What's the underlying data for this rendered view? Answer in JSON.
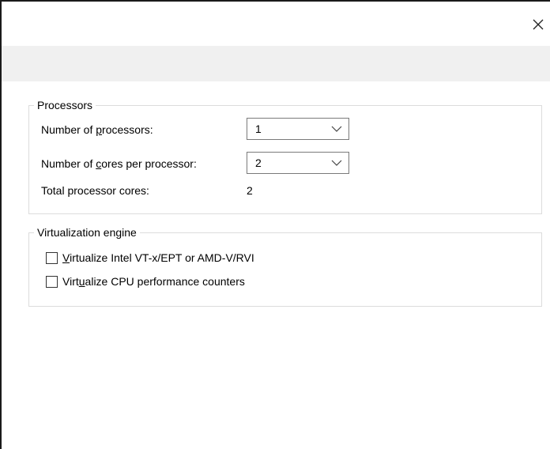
{
  "window": {
    "close_icon": "close-icon"
  },
  "processors": {
    "group_label": "Processors",
    "num_processors_label_pre": "Number of ",
    "num_processors_label_mnemonic": "p",
    "num_processors_label_post": "rocessors:",
    "num_processors_value": "1",
    "cores_label_pre": "Number of ",
    "cores_label_mnemonic": "c",
    "cores_label_post": "ores per processor:",
    "cores_value": "2",
    "total_label": "Total processor cores:",
    "total_value": "2"
  },
  "virtualization": {
    "group_label": "Virtualization engine",
    "vtx_label_mnemonic": "V",
    "vtx_label_post": "irtualize Intel VT-x/EPT or AMD-V/RVI",
    "vtx_checked": false,
    "perf_label_pre": "Virt",
    "perf_label_mnemonic": "u",
    "perf_label_post": "alize CPU performance counters",
    "perf_checked": false
  }
}
